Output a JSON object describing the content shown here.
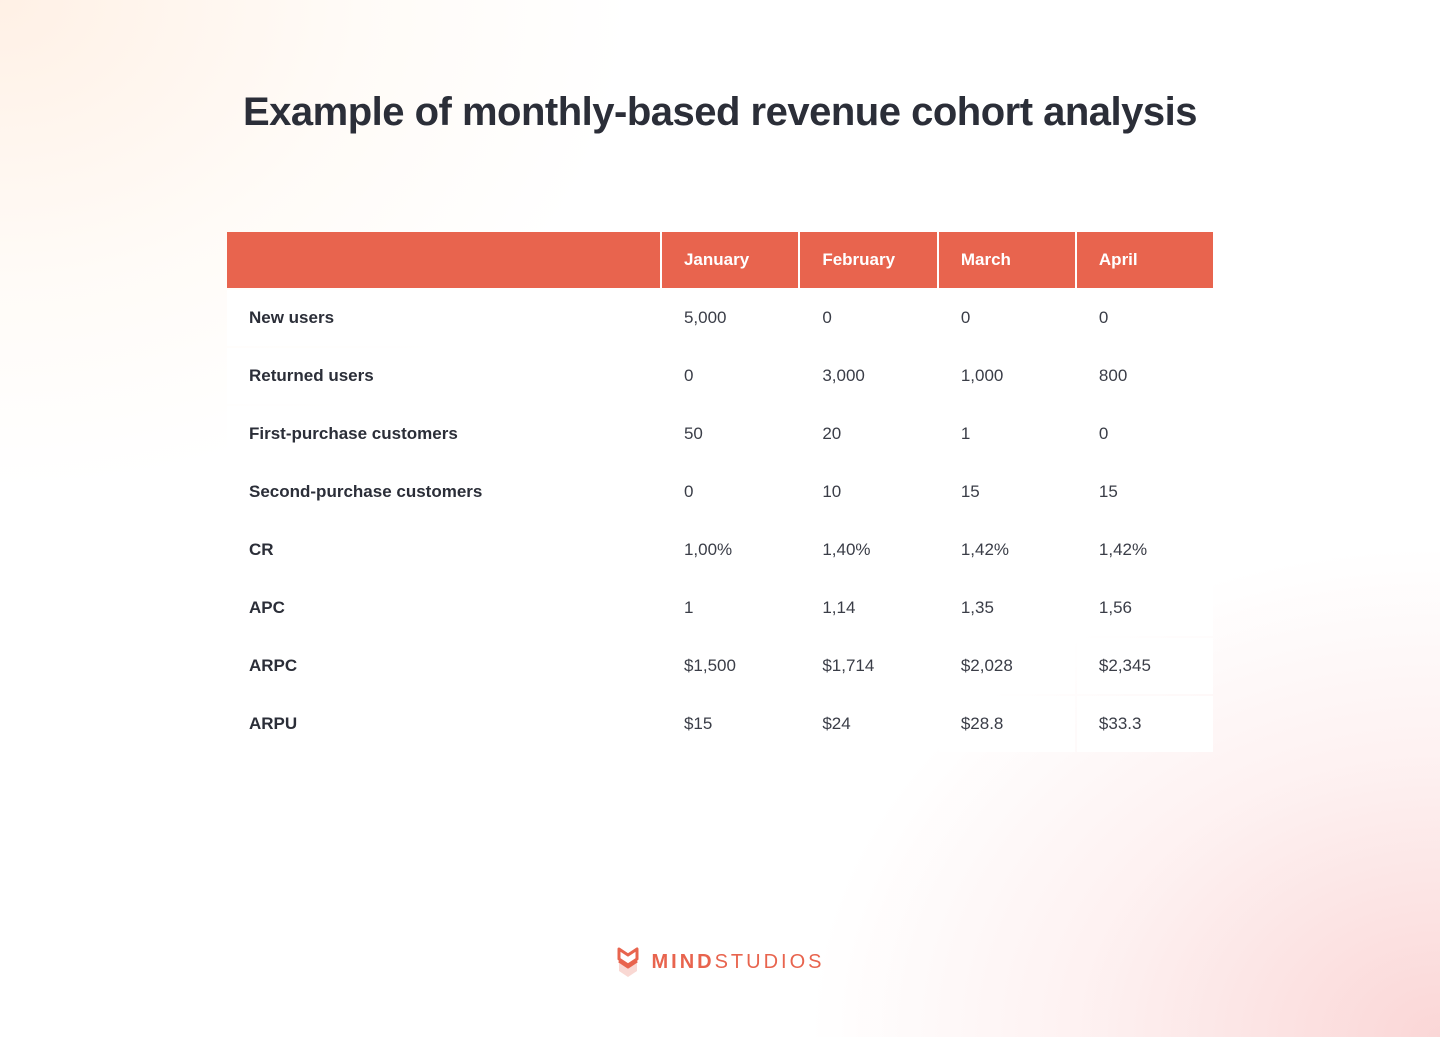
{
  "title": "Example of monthly-based revenue cohort analysis",
  "chart_data": {
    "type": "table",
    "columns": [
      "January",
      "February",
      "March",
      "April"
    ],
    "rows": [
      {
        "metric": "New users",
        "values": [
          "5,000",
          "0",
          "0",
          "0"
        ]
      },
      {
        "metric": "Returned users",
        "values": [
          "0",
          "3,000",
          "1,000",
          "800"
        ]
      },
      {
        "metric": "First-purchase customers",
        "values": [
          "50",
          "20",
          "1",
          "0"
        ]
      },
      {
        "metric": "Second-purchase customers",
        "values": [
          "0",
          "10",
          "15",
          "15"
        ]
      },
      {
        "metric": "CR",
        "values": [
          "1,00%",
          "1,40%",
          "1,42%",
          "1,42%"
        ]
      },
      {
        "metric": "APC",
        "values": [
          "1",
          "1,14",
          "1,35",
          "1,56"
        ]
      },
      {
        "metric": "ARPC",
        "values": [
          "$1,500",
          "$1,714",
          "$2,028",
          "$2,345"
        ]
      },
      {
        "metric": "ARPU",
        "values": [
          "$15",
          "$24",
          "$28.8",
          "$33.3"
        ]
      }
    ]
  },
  "brand": {
    "name_bold": "MIND",
    "name_rest": "STUDIOS"
  }
}
